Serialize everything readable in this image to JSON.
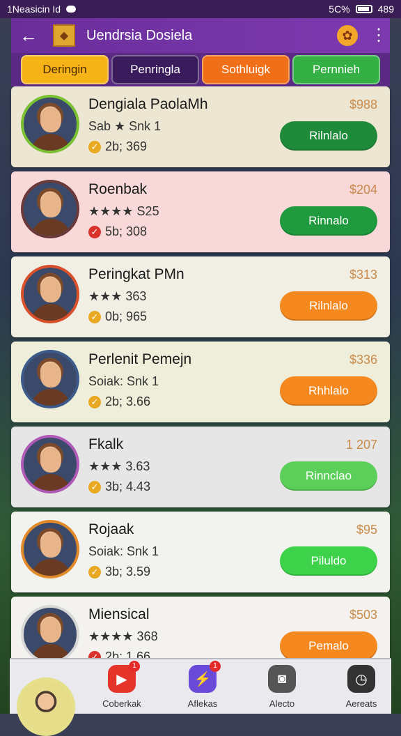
{
  "status_bar": {
    "left_text": "1Neasicin Id",
    "right_text": "5C%",
    "time": "489"
  },
  "app_bar": {
    "title": "Uendrsia Dosiela",
    "back_icon": "back-arrow-icon",
    "logo_icon": "app-logo-icon",
    "badge_icon": "trophy-icon",
    "more_icon": "more-vertical-icon"
  },
  "tabs": [
    {
      "label": "Deringin"
    },
    {
      "label": "Penringla"
    },
    {
      "label": "Sothluigk"
    },
    {
      "label": "Pernnieh"
    }
  ],
  "players": [
    {
      "name": "Dengiala PaolaMh",
      "stat1": "Sab ★ Snk 1",
      "stat2": "2b; 369",
      "price": "$988",
      "action": "Rilnlalo",
      "bg": "#ede6d3",
      "btn": "#1f8a3a",
      "ring": "#7ac232"
    },
    {
      "name": "Roenbak",
      "stat1": "★★★★ S25",
      "stat2": "5b; 308",
      "price": "$204",
      "action": "Rinnalo",
      "bg": "#f8d8d8",
      "btn": "#1f9a3e",
      "ring": "#6a3a3a"
    },
    {
      "name": "Peringkat PMn",
      "stat1": "★★★ 363",
      "stat2": "0b; 965",
      "price": "$313",
      "action": "Rilnlalo",
      "bg": "#f1efe4",
      "btn": "#f5881e",
      "ring": "#d9502a"
    },
    {
      "name": "Perlenit Pemejn",
      "stat1": "Soiak: Snk 1",
      "stat2": "2b; 3.66",
      "price": "$336",
      "action": "Rhhlalo",
      "bg": "#efeeda",
      "btn": "#f5881e",
      "ring": "#3b5a8a"
    },
    {
      "name": "Fkalk",
      "stat1": "★★★ 3.63",
      "stat2": "3b; 4.43",
      "price": "1 207",
      "action": "Rinnclao",
      "bg": "#e6e6e6",
      "btn": "#5ccf5a",
      "ring": "#b05ab8"
    },
    {
      "name": "Rojaak",
      "stat1": "Soiak: Snk 1",
      "stat2": "3b; 3.59",
      "price": "$95",
      "action": "Piluldo",
      "bg": "#f2f2ee",
      "btn": "#3ed24a",
      "ring": "#e08a2a"
    },
    {
      "name": "Miensical",
      "stat1": "★★★★ 368",
      "stat2": "2b; 1.66",
      "price": "$503",
      "action": "Pemalo",
      "bg": "#f3f2ee",
      "btn": "#f5881e",
      "ring": "#d8d8d8"
    }
  ],
  "bottom_nav": [
    {
      "label": "Coberkak",
      "icon": "play-icon",
      "badge": "1",
      "color": "#e5342a"
    },
    {
      "label": "Aflekas",
      "icon": "lightning-icon",
      "badge": "1",
      "color": "#6a4ad8"
    },
    {
      "label": "Alecto",
      "icon": "camera-icon",
      "badge": "",
      "color": "#555555"
    },
    {
      "label": "Aereats",
      "icon": "clock-icon",
      "badge": "",
      "color": "#333333"
    }
  ]
}
